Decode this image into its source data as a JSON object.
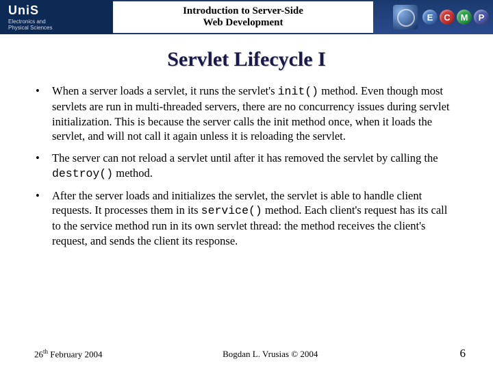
{
  "header": {
    "org": "UniS",
    "dept_line1": "Electronics and",
    "dept_line2": "Physical Sciences",
    "title_line1": "Introduction to Server-Side",
    "title_line2": "Web Development",
    "badges": {
      "e": "E",
      "c": "C",
      "m": "M",
      "p": "P"
    }
  },
  "slide_title": "Servlet Lifecycle I",
  "bullets": {
    "b1_pre": "When a server loads a servlet, it runs the servlet's ",
    "b1_code": "init()",
    "b1_post": " method. Even though most servlets are run in multi-threaded servers, there are no concurrency issues during servlet initialization. This is because the server calls the init method once, when it loads the servlet, and will not call it again unless it is reloading the servlet.",
    "b2_pre": "The server can not reload a servlet until after it has removed the servlet by calling the ",
    "b2_code": "destroy()",
    "b2_post": " method.",
    "b3_pre": "After the server loads and initializes the servlet, the servlet is able to handle client requests. It processes them in its ",
    "b3_code": "service()",
    "b3_post": " method. Each client's request has its call to the service method run in its own servlet thread: the method receives the client's request, and sends the client its response."
  },
  "footer": {
    "date_day": "26",
    "date_ord": "th",
    "date_rest": " February 2004",
    "author": "Bogdan L. Vrusias © 2004",
    "page": "6"
  }
}
